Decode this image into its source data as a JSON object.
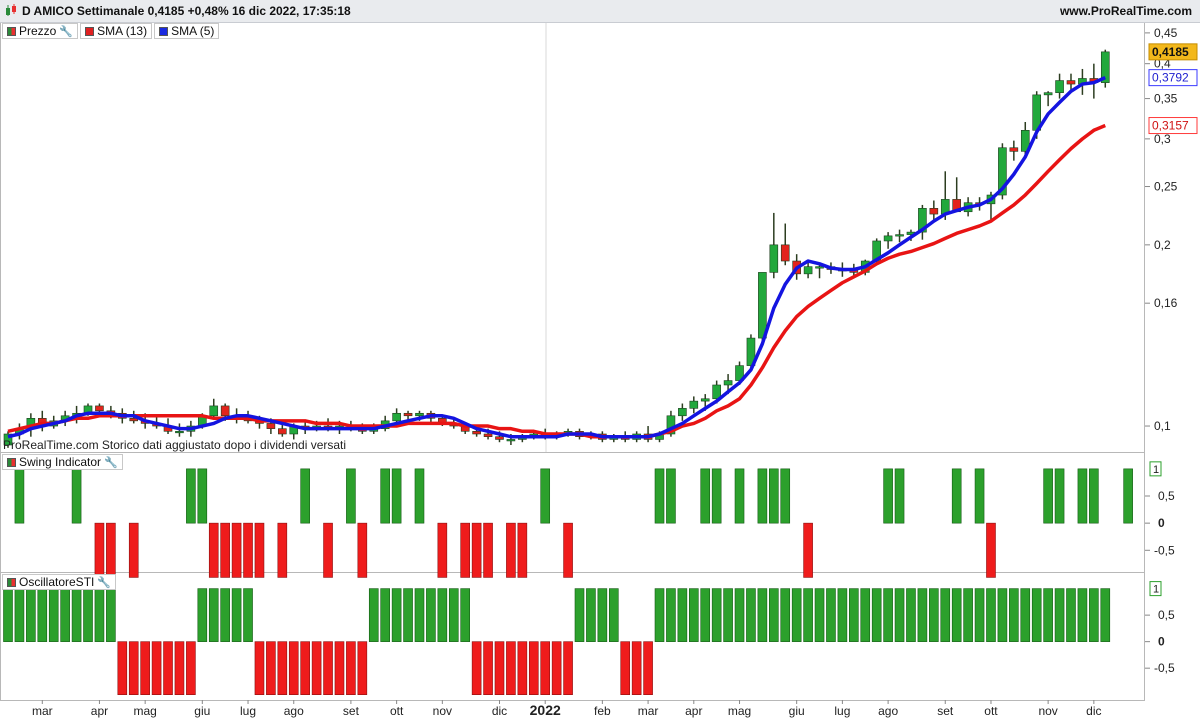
{
  "header": {
    "title": "D AMICO Settimanale 0,4185 +0,48% 16 dic 2022, 17:35:18",
    "brand": "www.ProRealTime.com"
  },
  "price_panel": {
    "legend": [
      {
        "label": "Prezzo",
        "swatch": "split",
        "has_wrench": true
      },
      {
        "label": "SMA (13)",
        "swatch": "red",
        "has_wrench": false
      },
      {
        "label": "SMA (5)",
        "swatch": "blue",
        "has_wrench": false
      }
    ],
    "note": "ProRealTime.com Storico dati aggiustato dopo i dividendi versati",
    "last_price_label": "0,4185",
    "sma5_label": "0,3792",
    "sma13_label": "0,3157",
    "y_ticks": [
      "0,45",
      "0,4",
      "0,35",
      "0,3",
      "0,25",
      "0,2",
      "0,16",
      "0,1"
    ]
  },
  "swing_panel": {
    "legend": "Swing Indicator",
    "box_label": "1",
    "y_ticks": [
      "0,5",
      "0",
      "-0,5"
    ]
  },
  "sti_panel": {
    "legend": "OscillatoreSTI",
    "box_label": "1",
    "y_ticks": [
      "0,5",
      "0",
      "-0,5"
    ]
  },
  "x_axis": {
    "labels": [
      {
        "text": "mar",
        "week": 3,
        "bold": false
      },
      {
        "text": "apr",
        "week": 8,
        "bold": false
      },
      {
        "text": "mag",
        "week": 12,
        "bold": false
      },
      {
        "text": "giu",
        "week": 17,
        "bold": false
      },
      {
        "text": "lug",
        "week": 21,
        "bold": false
      },
      {
        "text": "ago",
        "week": 25,
        "bold": false
      },
      {
        "text": "set",
        "week": 30,
        "bold": false
      },
      {
        "text": "ott",
        "week": 34,
        "bold": false
      },
      {
        "text": "nov",
        "week": 38,
        "bold": false
      },
      {
        "text": "dic",
        "week": 43,
        "bold": false
      },
      {
        "text": "2022",
        "week": 47,
        "bold": true
      },
      {
        "text": "feb",
        "week": 52,
        "bold": false
      },
      {
        "text": "mar",
        "week": 56,
        "bold": false
      },
      {
        "text": "apr",
        "week": 60,
        "bold": false
      },
      {
        "text": "mag",
        "week": 64,
        "bold": false
      },
      {
        "text": "giu",
        "week": 69,
        "bold": false
      },
      {
        "text": "lug",
        "week": 73,
        "bold": false
      },
      {
        "text": "ago",
        "week": 77,
        "bold": false
      },
      {
        "text": "set",
        "week": 82,
        "bold": false
      },
      {
        "text": "ott",
        "week": 86,
        "bold": false
      },
      {
        "text": "nov",
        "week": 91,
        "bold": false
      },
      {
        "text": "dic",
        "week": 95,
        "bold": false
      }
    ]
  },
  "chart_data": [
    {
      "type": "candlestick",
      "title": "D AMICO Settimanale",
      "period": "weekly",
      "y_range": [
        0.093,
        0.455
      ],
      "scale": "log",
      "colors": {
        "up": "#22a83c",
        "down": "#e3241c",
        "sma13": "#e81414",
        "sma5": "#1414e0"
      },
      "ohlc": [
        [
          0.093,
          0.098,
          0.092,
          0.097
        ],
        [
          0.097,
          0.101,
          0.095,
          0.099
        ],
        [
          0.099,
          0.105,
          0.096,
          0.103
        ],
        [
          0.103,
          0.106,
          0.098,
          0.1
        ],
        [
          0.1,
          0.104,
          0.099,
          0.102
        ],
        [
          0.102,
          0.106,
          0.1,
          0.104
        ],
        [
          0.104,
          0.108,
          0.101,
          0.105
        ],
        [
          0.105,
          0.109,
          0.104,
          0.108
        ],
        [
          0.108,
          0.109,
          0.104,
          0.106
        ],
        [
          0.106,
          0.108,
          0.103,
          0.105
        ],
        [
          0.105,
          0.107,
          0.101,
          0.103
        ],
        [
          0.103,
          0.106,
          0.101,
          0.102
        ],
        [
          0.102,
          0.105,
          0.099,
          0.101
        ],
        [
          0.101,
          0.104,
          0.099,
          0.1
        ],
        [
          0.1,
          0.103,
          0.097,
          0.098
        ],
        [
          0.098,
          0.101,
          0.096,
          0.098
        ],
        [
          0.098,
          0.102,
          0.096,
          0.1
        ],
        [
          0.1,
          0.105,
          0.099,
          0.104
        ],
        [
          0.104,
          0.111,
          0.103,
          0.108
        ],
        [
          0.108,
          0.109,
          0.102,
          0.104
        ],
        [
          0.104,
          0.107,
          0.101,
          0.103
        ],
        [
          0.103,
          0.106,
          0.101,
          0.102
        ],
        [
          0.102,
          0.104,
          0.099,
          0.101
        ],
        [
          0.101,
          0.103,
          0.097,
          0.099
        ],
        [
          0.099,
          0.101,
          0.096,
          0.097
        ],
        [
          0.097,
          0.101,
          0.095,
          0.1
        ],
        [
          0.1,
          0.102,
          0.097,
          0.099
        ],
        [
          0.099,
          0.102,
          0.098,
          0.1
        ],
        [
          0.1,
          0.103,
          0.098,
          0.099
        ],
        [
          0.099,
          0.102,
          0.097,
          0.1
        ],
        [
          0.1,
          0.102,
          0.098,
          0.099
        ],
        [
          0.099,
          0.101,
          0.097,
          0.098
        ],
        [
          0.098,
          0.101,
          0.097,
          0.099
        ],
        [
          0.099,
          0.104,
          0.098,
          0.102
        ],
        [
          0.102,
          0.107,
          0.101,
          0.105
        ],
        [
          0.105,
          0.106,
          0.102,
          0.104
        ],
        [
          0.104,
          0.106,
          0.102,
          0.105
        ],
        [
          0.105,
          0.106,
          0.101,
          0.103
        ],
        [
          0.103,
          0.104,
          0.1,
          0.101
        ],
        [
          0.101,
          0.103,
          0.099,
          0.1
        ],
        [
          0.1,
          0.101,
          0.097,
          0.098
        ],
        [
          0.098,
          0.1,
          0.096,
          0.097
        ],
        [
          0.097,
          0.099,
          0.095,
          0.096
        ],
        [
          0.096,
          0.098,
          0.094,
          0.095
        ],
        [
          0.095,
          0.097,
          0.093,
          0.095
        ],
        [
          0.095,
          0.097,
          0.094,
          0.096
        ],
        [
          0.096,
          0.098,
          0.095,
          0.097
        ],
        [
          0.097,
          0.099,
          0.095,
          0.096
        ],
        [
          0.096,
          0.098,
          0.095,
          0.097
        ],
        [
          0.097,
          0.099,
          0.096,
          0.098
        ],
        [
          0.098,
          0.099,
          0.095,
          0.096
        ],
        [
          0.096,
          0.098,
          0.095,
          0.097
        ],
        [
          0.097,
          0.098,
          0.094,
          0.095
        ],
        [
          0.095,
          0.097,
          0.094,
          0.096
        ],
        [
          0.096,
          0.098,
          0.094,
          0.095
        ],
        [
          0.095,
          0.098,
          0.094,
          0.097
        ],
        [
          0.097,
          0.1,
          0.094,
          0.095
        ],
        [
          0.095,
          0.098,
          0.094,
          0.097
        ],
        [
          0.097,
          0.106,
          0.096,
          0.104
        ],
        [
          0.104,
          0.109,
          0.102,
          0.107
        ],
        [
          0.107,
          0.112,
          0.105,
          0.11
        ],
        [
          0.11,
          0.113,
          0.106,
          0.111
        ],
        [
          0.111,
          0.119,
          0.109,
          0.117
        ],
        [
          0.117,
          0.122,
          0.113,
          0.119
        ],
        [
          0.119,
          0.128,
          0.117,
          0.126
        ],
        [
          0.126,
          0.142,
          0.124,
          0.14
        ],
        [
          0.14,
          0.172,
          0.138,
          0.18
        ],
        [
          0.18,
          0.226,
          0.176,
          0.2
        ],
        [
          0.2,
          0.217,
          0.185,
          0.188
        ],
        [
          0.188,
          0.193,
          0.175,
          0.179
        ],
        [
          0.179,
          0.187,
          0.176,
          0.184
        ],
        [
          0.184,
          0.186,
          0.176,
          0.184
        ],
        [
          0.184,
          0.187,
          0.179,
          0.182
        ],
        [
          0.182,
          0.187,
          0.177,
          0.182
        ],
        [
          0.182,
          0.186,
          0.176,
          0.18
        ],
        [
          0.18,
          0.189,
          0.178,
          0.188
        ],
        [
          0.188,
          0.205,
          0.186,
          0.203
        ],
        [
          0.203,
          0.21,
          0.197,
          0.207
        ],
        [
          0.207,
          0.212,
          0.202,
          0.208
        ],
        [
          0.208,
          0.212,
          0.203,
          0.21
        ],
        [
          0.21,
          0.233,
          0.204,
          0.23
        ],
        [
          0.23,
          0.237,
          0.218,
          0.225
        ],
        [
          0.225,
          0.265,
          0.22,
          0.238
        ],
        [
          0.238,
          0.259,
          0.23,
          0.227
        ],
        [
          0.227,
          0.24,
          0.223,
          0.235
        ],
        [
          0.235,
          0.24,
          0.228,
          0.234
        ],
        [
          0.234,
          0.245,
          0.22,
          0.242
        ],
        [
          0.242,
          0.295,
          0.238,
          0.29
        ],
        [
          0.29,
          0.298,
          0.276,
          0.286
        ],
        [
          0.286,
          0.32,
          0.282,
          0.31
        ],
        [
          0.31,
          0.36,
          0.3,
          0.355
        ],
        [
          0.355,
          0.36,
          0.34,
          0.358
        ],
        [
          0.358,
          0.385,
          0.35,
          0.375
        ],
        [
          0.375,
          0.385,
          0.36,
          0.37
        ],
        [
          0.37,
          0.392,
          0.355,
          0.378
        ],
        [
          0.378,
          0.4,
          0.35,
          0.372
        ],
        [
          0.372,
          0.422,
          0.365,
          0.4185
        ]
      ],
      "sma13": [
        0.098,
        0.099,
        0.1,
        0.101,
        0.101,
        0.102,
        0.103,
        0.103,
        0.104,
        0.104,
        0.104,
        0.104,
        0.104,
        0.104,
        0.104,
        0.104,
        0.104,
        0.104,
        0.103,
        0.103,
        0.103,
        0.103,
        0.102,
        0.102,
        0.102,
        0.102,
        0.102,
        0.101,
        0.101,
        0.101,
        0.1,
        0.1,
        0.1,
        0.1,
        0.1,
        0.101,
        0.101,
        0.101,
        0.101,
        0.101,
        0.1,
        0.1,
        0.1,
        0.099,
        0.099,
        0.098,
        0.098,
        0.097,
        0.097,
        0.097,
        0.097,
        0.096,
        0.096,
        0.096,
        0.096,
        0.096,
        0.096,
        0.097,
        0.098,
        0.1,
        0.101,
        0.103,
        0.106,
        0.108,
        0.111,
        0.117,
        0.125,
        0.135,
        0.144,
        0.152,
        0.158,
        0.163,
        0.168,
        0.173,
        0.177,
        0.181,
        0.186,
        0.19,
        0.193,
        0.195,
        0.198,
        0.201,
        0.205,
        0.209,
        0.212,
        0.215,
        0.219,
        0.226,
        0.233,
        0.242,
        0.253,
        0.265,
        0.277,
        0.289,
        0.3,
        0.31,
        0.3157
      ],
      "sma5": [
        0.096,
        0.097,
        0.099,
        0.1,
        0.101,
        0.102,
        0.104,
        0.105,
        0.105,
        0.105,
        0.104,
        0.104,
        0.102,
        0.101,
        0.1,
        0.099,
        0.099,
        0.1,
        0.101,
        0.103,
        0.104,
        0.104,
        0.103,
        0.102,
        0.101,
        0.1,
        0.099,
        0.099,
        0.099,
        0.099,
        0.099,
        0.099,
        0.099,
        0.1,
        0.101,
        0.102,
        0.103,
        0.104,
        0.104,
        0.103,
        0.101,
        0.099,
        0.098,
        0.097,
        0.096,
        0.096,
        0.096,
        0.096,
        0.096,
        0.097,
        0.097,
        0.097,
        0.096,
        0.096,
        0.096,
        0.096,
        0.096,
        0.097,
        0.099,
        0.101,
        0.104,
        0.107,
        0.11,
        0.114,
        0.118,
        0.124,
        0.137,
        0.157,
        0.172,
        0.183,
        0.188,
        0.186,
        0.183,
        0.182,
        0.182,
        0.184,
        0.189,
        0.194,
        0.2,
        0.206,
        0.212,
        0.219,
        0.225,
        0.228,
        0.231,
        0.233,
        0.238,
        0.248,
        0.262,
        0.28,
        0.308,
        0.33,
        0.345,
        0.36,
        0.37,
        0.372,
        0.3792
      ]
    },
    {
      "type": "bar",
      "title": "Swing Indicator",
      "y_range": [
        -0.9,
        1.2
      ],
      "values": [
        0,
        1,
        0,
        0,
        0,
        0,
        1,
        0,
        -1,
        -1,
        0,
        -1,
        0,
        0,
        0,
        0,
        1,
        1,
        -1,
        -1,
        -1,
        -1,
        -1,
        0,
        -1,
        0,
        1,
        0,
        -1,
        0,
        1,
        -1,
        0,
        1,
        1,
        0,
        1,
        0,
        -1,
        0,
        -1,
        -1,
        -1,
        0,
        -1,
        -1,
        0,
        1,
        0,
        -1,
        0,
        0,
        0,
        0,
        0,
        0,
        0,
        1,
        1,
        0,
        0,
        1,
        1,
        0,
        1,
        0,
        1,
        1,
        1,
        0,
        -1,
        0,
        0,
        0,
        0,
        0,
        0,
        1,
        1,
        0,
        0,
        0,
        0,
        1,
        0,
        1,
        -1,
        0,
        0,
        0,
        0,
        1,
        1,
        0,
        1,
        1,
        0,
        0,
        1
      ]
    },
    {
      "type": "bar",
      "title": "OscillatoreSTI",
      "y_range": [
        -1.1,
        1.2
      ],
      "values": [
        1,
        1,
        1,
        1,
        1,
        1,
        1,
        1,
        1,
        1,
        -1,
        -1,
        -1,
        -1,
        -1,
        -1,
        -1,
        1,
        1,
        1,
        1,
        1,
        -1,
        -1,
        -1,
        -1,
        -1,
        -1,
        -1,
        -1,
        -1,
        -1,
        1,
        1,
        1,
        1,
        1,
        1,
        1,
        1,
        1,
        -1,
        -1,
        -1,
        -1,
        -1,
        -1,
        -1,
        -1,
        -1,
        1,
        1,
        1,
        1,
        -1,
        -1,
        -1,
        1,
        1,
        1,
        1,
        1,
        1,
        1,
        1,
        1,
        1,
        1,
        1,
        1,
        1,
        1,
        1,
        1,
        1,
        1,
        1,
        1,
        1,
        1,
        1,
        1,
        1,
        1,
        1,
        1,
        1,
        1,
        1,
        1,
        1,
        1,
        1,
        1,
        1,
        1,
        1
      ]
    }
  ]
}
